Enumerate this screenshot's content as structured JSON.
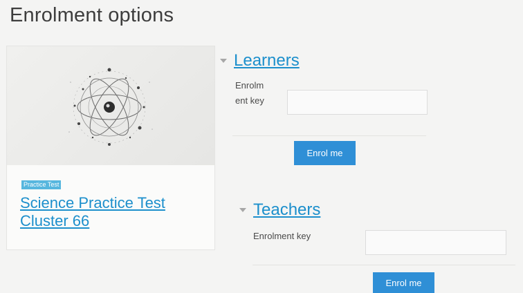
{
  "page": {
    "title": "Enrolment options"
  },
  "course": {
    "badge": "Practice Test",
    "name": "Science Practice Test Cluster 66",
    "image_icon": "atom-illustration"
  },
  "learners": {
    "heading": "Learners",
    "key_label": "Enrolment key",
    "key_value": "",
    "button_label": "Enrol me"
  },
  "teachers": {
    "heading": "Teachers",
    "key_label": "Enrolment key",
    "key_value": "",
    "button_label": "Enrol me"
  },
  "colors": {
    "link": "#1c8fcc",
    "button": "#2f8fd6",
    "badge": "#56b6de",
    "background": "#f4f4f3"
  }
}
